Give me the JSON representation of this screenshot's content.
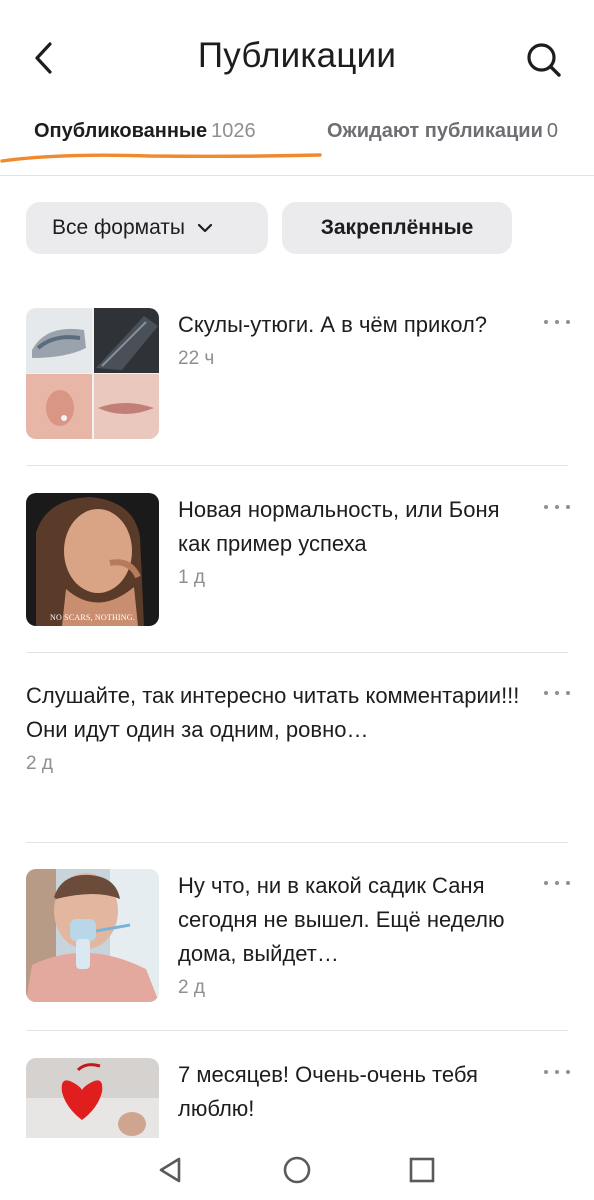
{
  "header": {
    "title": "Публикации"
  },
  "tabs": [
    {
      "label": "Опубликованные",
      "count": "1026",
      "active": true
    },
    {
      "label": "Ожидают публикации",
      "count": "0",
      "active": false
    }
  ],
  "filters": {
    "formats_label": "Все форматы",
    "pinned_label": "Закреплённые"
  },
  "posts": [
    {
      "title": "Скулы-утюги. А в чём прикол?",
      "time": "22 ч",
      "has_thumbnail": true
    },
    {
      "title": "Новая нормальность, или Боня как пример успеха",
      "time": "1 д",
      "has_thumbnail": true,
      "thumbnail_caption": "NO SCARS, NOTHING."
    },
    {
      "title": "Слушайте, так интересно читать комментарии!!! Они идут один за одним, ровно…",
      "time": "2 д",
      "has_thumbnail": false
    },
    {
      "title": "Ну что, ни в какой садик Саня сегодня не вышел. Ещё неделю дома, выйдет…",
      "time": "2 д",
      "has_thumbnail": true
    },
    {
      "title": "7 месяцев! Очень-очень тебя люблю!",
      "time": "",
      "has_thumbnail": true
    }
  ],
  "colors": {
    "accent": "#f08a2c",
    "text": "#1d1d1f",
    "muted": "#8e8e93",
    "chip_bg": "#ebebee",
    "divider": "#e3e3e6"
  },
  "icons": {
    "back": "chevron-left-icon",
    "search": "search-icon",
    "formats": "chevron-down-icon",
    "more": "more-horizontal-icon",
    "nav_back": "triangle-back-icon",
    "nav_home": "circle-home-icon",
    "nav_recents": "square-recents-icon"
  }
}
